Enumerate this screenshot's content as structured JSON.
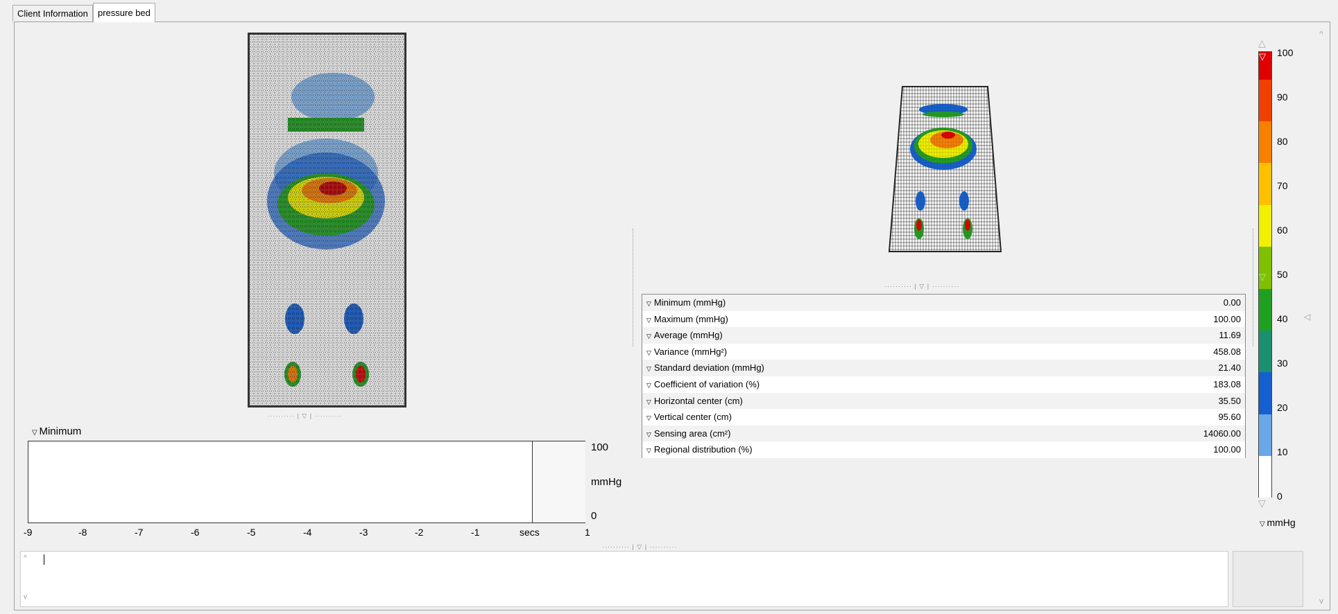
{
  "tabs": [
    {
      "label": "Client Information",
      "active": false
    },
    {
      "label": "pressure bed",
      "active": true
    }
  ],
  "trend": {
    "title": "Minimum",
    "y_max": "100",
    "y_unit": "mmHg",
    "y_min": "0",
    "x_labels": [
      "-9",
      "-8",
      "-7",
      "-6",
      "-5",
      "-4",
      "-3",
      "-2",
      "-1",
      "secs",
      "1"
    ]
  },
  "stats": [
    {
      "label": "Minimum (mmHg)",
      "value": "0.00"
    },
    {
      "label": "Maximum (mmHg)",
      "value": "100.00"
    },
    {
      "label": "Average (mmHg)",
      "value": "11.69"
    },
    {
      "label": "Variance (mmHg²)",
      "value": "458.08"
    },
    {
      "label": "Standard deviation (mmHg)",
      "value": "21.40"
    },
    {
      "label": "Coefficient of variation (%)",
      "value": "183.08"
    },
    {
      "label": "Horizontal center (cm)",
      "value": "35.50"
    },
    {
      "label": "Vertical center (cm)",
      "value": "95.60"
    },
    {
      "label": "Sensing area (cm²)",
      "value": "14060.00"
    },
    {
      "label": "Regional distribution (%)",
      "value": "100.00"
    }
  ],
  "color_scale": {
    "unit": "mmHg",
    "labels": [
      "100",
      "90",
      "80",
      "70",
      "60",
      "50",
      "40",
      "30",
      "20",
      "10",
      "0"
    ],
    "colors": [
      "#e00000",
      "#f04000",
      "#f88000",
      "#ffc000",
      "#f0f000",
      "#80c000",
      "#20a020",
      "#1a9070",
      "#1560d0",
      "#6aa8e8",
      "#ffffff"
    ]
  },
  "log": {
    "text": ""
  }
}
